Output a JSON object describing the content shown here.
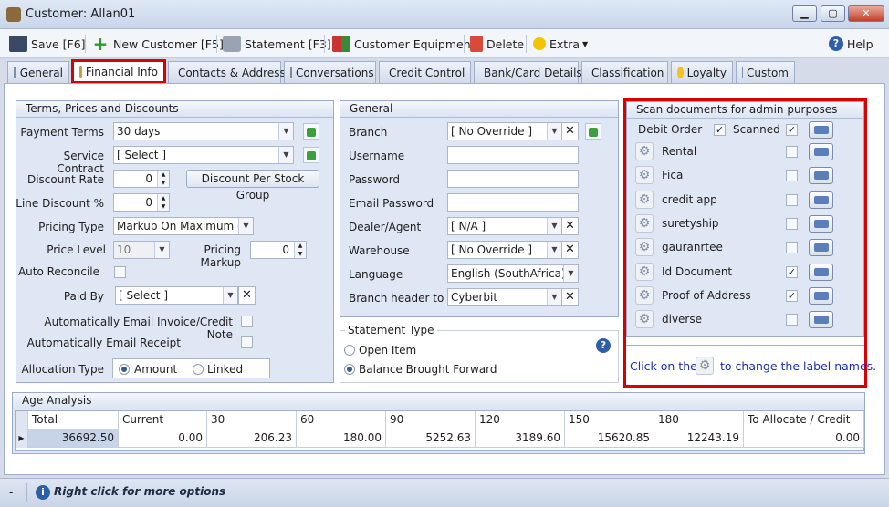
{
  "window": {
    "title": "Customer: Allan01"
  },
  "toolbar": {
    "save": "Save [F6]",
    "new_customer": "New Customer [F5]",
    "statement": "Statement [F3]",
    "customer_equipment": "Customer Equipment",
    "delete": "Delete",
    "extra": "Extra",
    "help": "Help"
  },
  "tabs": [
    {
      "label": "General"
    },
    {
      "label": "Financial Info"
    },
    {
      "label": "Contacts & Address"
    },
    {
      "label": "Conversations"
    },
    {
      "label": "Credit Control"
    },
    {
      "label": "Bank/Card Details"
    },
    {
      "label": "Classification"
    },
    {
      "label": "Loyalty"
    },
    {
      "label": "Custom"
    }
  ],
  "terms": {
    "title": "Terms, Prices and Discounts",
    "payment_terms_label": "Payment Terms",
    "payment_terms": "30 days",
    "service_contract_label": "Service Contract",
    "service_contract": "[ Select ]",
    "discount_rate_label": "Discount Rate",
    "discount_rate": "0",
    "discount_per_stock_group": "Discount Per Stock Group",
    "line_discount_label": "Line Discount %",
    "line_discount": "0",
    "pricing_type_label": "Pricing Type",
    "pricing_type": "Markup On Maximum of ...",
    "price_level_label": "Price Level",
    "price_level": "10",
    "pricing_markup_label": "Pricing Markup",
    "pricing_markup": "0",
    "auto_reconcile_label": "Auto Reconcile",
    "paid_by_label": "Paid By",
    "paid_by": "[ Select ]",
    "auto_email_invoice_label": "Automatically Email Invoice/Credit Note",
    "auto_email_receipt_label": "Automatically Email Receipt",
    "allocation_type_label": "Allocation Type",
    "alloc_amount": "Amount",
    "alloc_linked": "Linked"
  },
  "general": {
    "title": "General",
    "branch_label": "Branch",
    "branch": "[ No Override ]",
    "username_label": "Username",
    "password_label": "Password",
    "email_password_label": "Email Password",
    "dealer_label": "Dealer/Agent",
    "dealer": "[ N/A ]",
    "warehouse_label": "Warehouse",
    "warehouse": "[ No Override ]",
    "language_label": "Language",
    "language": "English (SouthAfrica)",
    "branch_header_label": "Branch header to use",
    "branch_header": "Cyberbit"
  },
  "statement": {
    "title": "Statement Type",
    "open_item": "Open Item",
    "balance_bf": "Balance Brought Forward"
  },
  "scan": {
    "title": "Scan documents for admin purposes",
    "debit_order": "Debit Order",
    "scanned": "Scanned",
    "docs": [
      {
        "label": "Rental",
        "checked": false
      },
      {
        "label": "Fica",
        "checked": false
      },
      {
        "label": "credit app",
        "checked": false
      },
      {
        "label": "suretyship",
        "checked": false
      },
      {
        "label": "gauranrtee",
        "checked": false
      },
      {
        "label": "Id Document",
        "checked": true
      },
      {
        "label": "Proof of Address",
        "checked": true
      },
      {
        "label": "diverse",
        "checked": false
      }
    ],
    "hint_prefix": "Click on the",
    "hint_suffix": "to change the label names."
  },
  "age": {
    "title": "Age Analysis",
    "headers": [
      "Total",
      "Current",
      "30",
      "60",
      "90",
      "120",
      "150",
      "180",
      "To Allocate / Credit"
    ],
    "row": [
      "36692.50",
      "0.00",
      "206.23",
      "180.00",
      "5252.63",
      "3189.60",
      "15620.85",
      "12243.19",
      "0.00"
    ]
  },
  "status": {
    "dash": "-",
    "hint": "Right click for more options"
  }
}
